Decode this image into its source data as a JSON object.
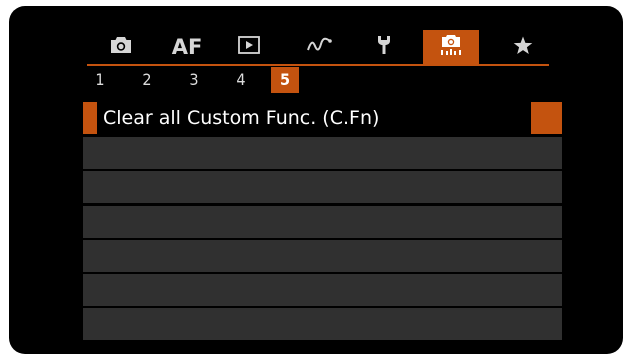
{
  "tabs": [
    {
      "id": "shooting",
      "icon": "camera-icon"
    },
    {
      "id": "af",
      "label": "AF"
    },
    {
      "id": "playback",
      "icon": "play-icon"
    },
    {
      "id": "wireless",
      "icon": "wireless-icon"
    },
    {
      "id": "setup",
      "icon": "wrench-icon"
    },
    {
      "id": "custom-functions",
      "icon": "custom-functions-camera-icon",
      "active": true
    },
    {
      "id": "my-menu",
      "icon": "star-icon"
    }
  ],
  "pages": [
    "1",
    "2",
    "3",
    "4",
    "5"
  ],
  "active_page": "5",
  "menu": {
    "items": [
      {
        "label": "Clear all Custom Func. (C.Fn)",
        "selected": true
      },
      {
        "label": ""
      },
      {
        "label": ""
      },
      {
        "label": ""
      },
      {
        "label": ""
      },
      {
        "label": ""
      }
    ]
  },
  "colors": {
    "accent": "#c4530f",
    "background": "#000000",
    "row": "#303030",
    "text": "#ffffff"
  }
}
